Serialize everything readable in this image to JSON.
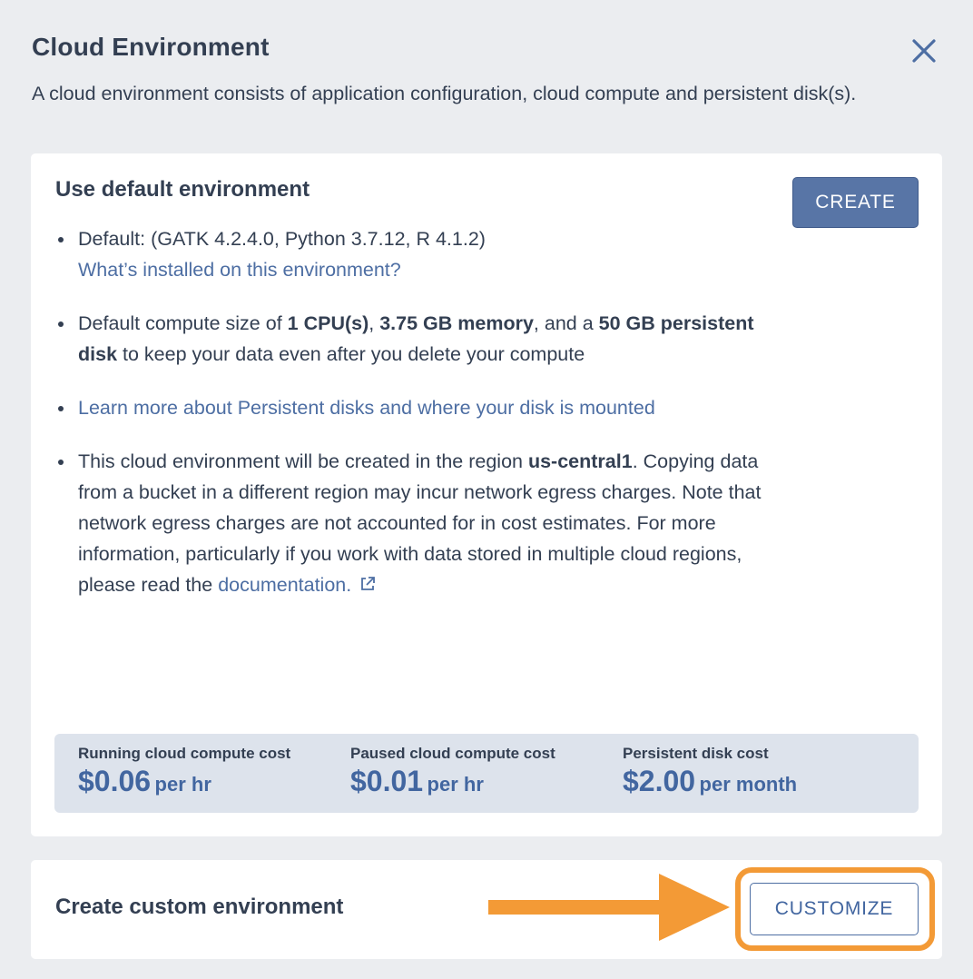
{
  "header": {
    "title": "Cloud Environment",
    "description": "A cloud environment consists of application configuration, cloud compute and persistent disk(s)."
  },
  "default_env": {
    "title": "Use default environment",
    "create_label": "CREATE",
    "bullet1": {
      "text": "Default: (GATK 4.2.4.0, Python 3.7.12, R 4.1.2)",
      "link": "What’s installed on this environment?"
    },
    "bullet2": {
      "p1": "Default compute size of ",
      "cpu": "1 CPU(s)",
      "p2": ", ",
      "memory": "3.75 GB memory",
      "p3": ", and a ",
      "disk": "50 GB persistent disk",
      "p4": " to keep your data even after you delete your compute"
    },
    "bullet3": {
      "link": "Learn more about Persistent disks and where your disk is mounted"
    },
    "bullet4": {
      "p1": "This cloud environment will be created in the region ",
      "region": "us-central1",
      "p2": ". Copying data from a bucket in a different region may incur network egress charges. Note that network egress charges are not accounted for in cost estimates. For more information, particularly if you work with data stored in multiple cloud regions, please read the ",
      "link": "documentation."
    },
    "costs": [
      {
        "label": "Running cloud compute cost",
        "amount": "$0.06",
        "unit": "per hr"
      },
      {
        "label": "Paused cloud compute cost",
        "amount": "$0.01",
        "unit": "per hr"
      },
      {
        "label": "Persistent disk cost",
        "amount": "$2.00",
        "unit": "per month"
      }
    ]
  },
  "custom_env": {
    "title": "Create custom environment",
    "customize_label": "CUSTOMIZE"
  },
  "colors": {
    "accent": "#5875a6",
    "link": "#4d6ea3",
    "highlight": "#f39a36"
  }
}
